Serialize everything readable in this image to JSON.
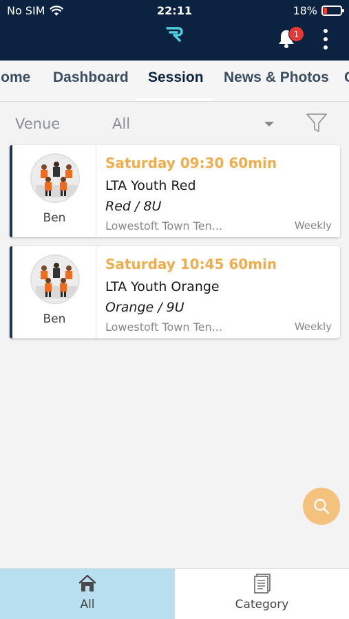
{
  "status": {
    "carrier": "No SIM",
    "time": "22:11",
    "battery": "18%",
    "battery_level": 0.18
  },
  "header": {
    "notification_count": "1"
  },
  "tabs": [
    {
      "label": "Home"
    },
    {
      "label": "Dashboard"
    },
    {
      "label": "Session"
    },
    {
      "label": "News & Photos"
    }
  ],
  "filter": {
    "label": "Venue",
    "value": "All"
  },
  "sessions": [
    {
      "time": "Saturday 09:30 60min",
      "title": "LTA Youth Red",
      "level": "Red / 8U",
      "venue": "Lowestoft Town Ten...",
      "frequency": "Weekly",
      "coach": "Ben"
    },
    {
      "time": "Saturday 10:45 60min",
      "title": "LTA Youth Orange",
      "level": "Orange / 9U",
      "venue": "Lowestoft Town Ten...",
      "frequency": "Weekly",
      "coach": "Ben"
    }
  ],
  "bottom_nav": [
    {
      "label": "All",
      "icon": "home-icon"
    },
    {
      "label": "Category",
      "icon": "document-icon"
    }
  ],
  "colors": {
    "header": "#0b2340",
    "accent": "#f0ad4e",
    "active_nav": "#b8dff0",
    "logo": "#4fd1e0"
  }
}
